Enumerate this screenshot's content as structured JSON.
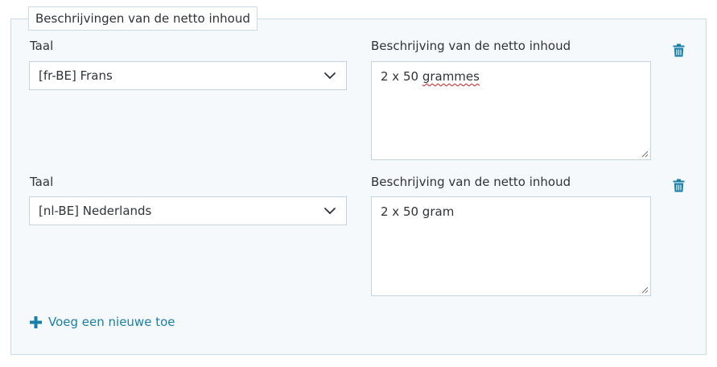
{
  "section": {
    "legend": "Beschrijvingen van de netto inhoud"
  },
  "rows": [
    {
      "language_label": "Taal",
      "language_value": "[fr-BE] Frans",
      "description_label": "Beschrijving van de netto inhoud",
      "description_prefix": "2 x 50 ",
      "description_flagged_word": "grammes"
    },
    {
      "language_label": "Taal",
      "language_value": "[nl-BE] Nederlands",
      "description_label": "Beschrijving van de netto inhoud",
      "description_value": "2 x 50 gram"
    }
  ],
  "add_link": {
    "label": "Voeg een nieuwe toe"
  },
  "colors": {
    "accent": "#1a7fa8",
    "border": "#c9dbe6",
    "panel_bg": "#f6f9fb",
    "spellcheck": "#d21d1d"
  },
  "icons": {
    "delete": "trash-icon",
    "dropdown": "chevron-down-icon",
    "add": "plus-icon",
    "resize": "resize-grip-icon"
  }
}
